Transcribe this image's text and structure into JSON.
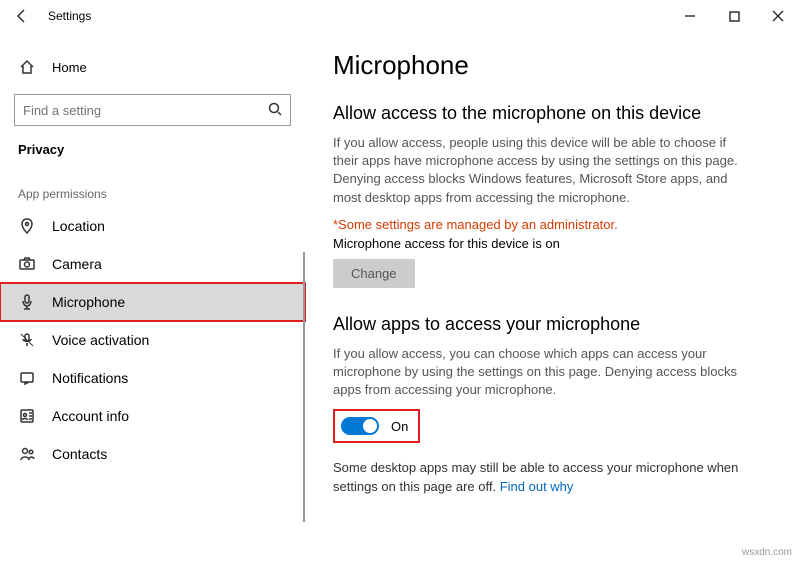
{
  "titlebar": {
    "title": "Settings"
  },
  "sidebar": {
    "home_label": "Home",
    "search_placeholder": "Find a setting",
    "category_label": "Privacy",
    "section_header": "App permissions",
    "items": [
      {
        "label": "Location"
      },
      {
        "label": "Camera"
      },
      {
        "label": "Microphone"
      },
      {
        "label": "Voice activation"
      },
      {
        "label": "Notifications"
      },
      {
        "label": "Account info"
      },
      {
        "label": "Contacts"
      }
    ]
  },
  "content": {
    "page_title": "Microphone",
    "section1": {
      "title": "Allow access to the microphone on this device",
      "desc": "If you allow access, people using this device will be able to choose if their apps have microphone access by using the settings on this page. Denying access blocks Windows features, Microsoft Store apps, and most desktop apps from accessing the microphone.",
      "admin_warning": "*Some settings are managed by an administrator.",
      "device_status": "Microphone access for this device is on",
      "change_button": "Change"
    },
    "section2": {
      "title": "Allow apps to access your microphone",
      "desc": "If you allow access, you can choose which apps can access your microphone by using the settings on this page. Denying access blocks apps from accessing your microphone.",
      "toggle_state": "On",
      "footer_note": "Some desktop apps may still be able to access your microphone when settings on this page are off. ",
      "footer_link": "Find out why"
    }
  },
  "watermark": "wsxdn.com"
}
